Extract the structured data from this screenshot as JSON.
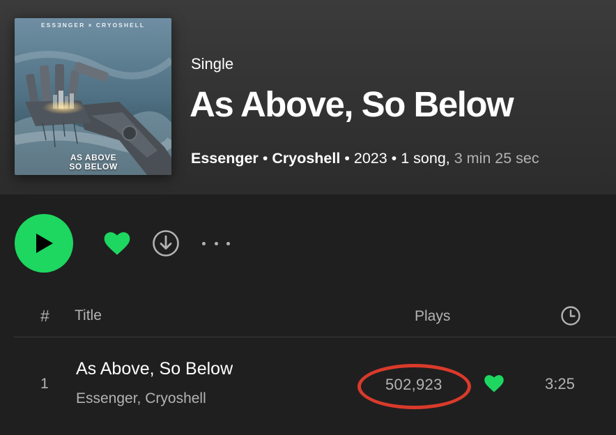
{
  "album": {
    "type_label": "Single",
    "title": "As Above, So Below",
    "artist_1": "Essenger",
    "artist_2": "Cryoshell",
    "year": "2023",
    "song_count": "1 song,",
    "duration": "3 min 25 sec",
    "separator": "•",
    "cover": {
      "artist_text": "ESSƎNGER × CRYOSHELL",
      "title_line_1": "AS ABOVE",
      "title_line_2": "SO BELOW"
    }
  },
  "controls": {
    "play_icon": "play-icon",
    "like_icon": "heart-icon",
    "download_icon": "download-icon",
    "more_icon": "more-horizontal-icon"
  },
  "table": {
    "headers": {
      "number": "#",
      "title": "Title",
      "plays": "Plays",
      "duration_icon": "clock-icon"
    },
    "rows": [
      {
        "number": "1",
        "title": "As Above, So Below",
        "artists": "Essenger, Cryoshell",
        "plays": "502,923",
        "liked": true,
        "duration": "3:25"
      }
    ]
  },
  "colors": {
    "accent_green": "#1ed760",
    "annotation_red": "#d93a2b",
    "background": "#1f1f1f",
    "muted_text": "#b3b3b3"
  }
}
